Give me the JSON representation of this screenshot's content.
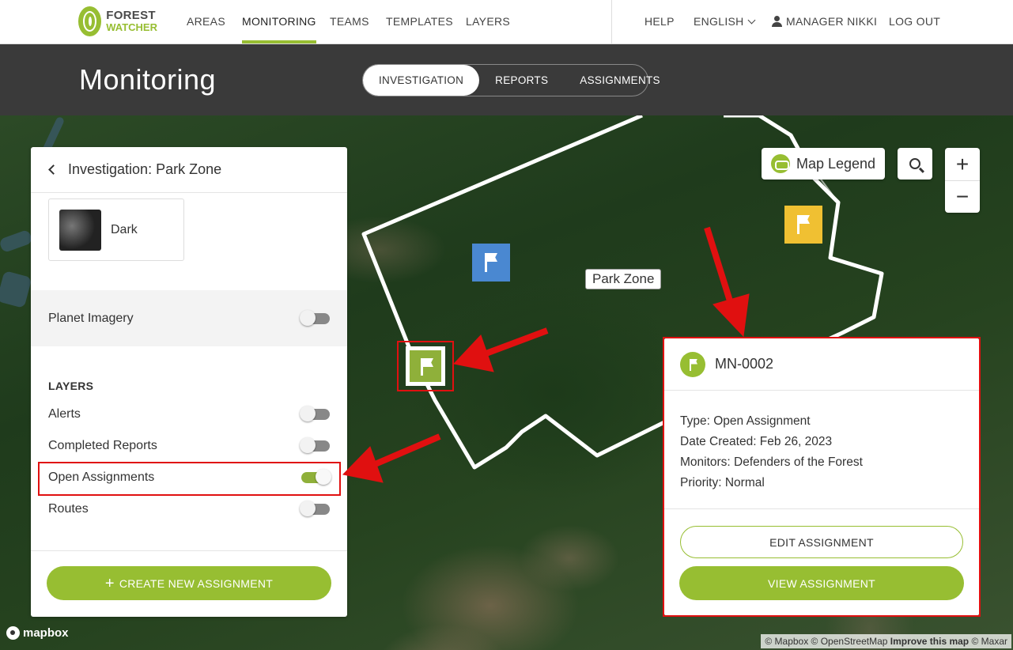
{
  "nav": {
    "logo_line1": "FOREST",
    "logo_line2": "WATCHER",
    "items": [
      "AREAS",
      "MONITORING",
      "TEAMS",
      "TEMPLATES",
      "LAYERS"
    ],
    "help": "HELP",
    "language": "ENGLISH",
    "user": "MANAGER NIKKI",
    "logout": "LOG OUT"
  },
  "subheader": {
    "title": "Monitoring",
    "tabs": [
      "INVESTIGATION",
      "REPORTS",
      "ASSIGNMENTS"
    ]
  },
  "panel": {
    "title": "Investigation: Park Zone",
    "basemap_label": "Dark",
    "planet_label": "Planet Imagery",
    "layers_title": "LAYERS",
    "layers": [
      {
        "label": "Alerts",
        "on": false
      },
      {
        "label": "Completed Reports",
        "on": false
      },
      {
        "label": "Open Assignments",
        "on": true
      },
      {
        "label": "Routes",
        "on": false
      }
    ],
    "create_button": "CREATE NEW ASSIGNMENT"
  },
  "map": {
    "zone_label": "Park Zone",
    "legend_button": "Map Legend",
    "zoom_in": "+",
    "zoom_out": "−",
    "mapbox_label": "mapbox",
    "attribution": {
      "a": "© Mapbox © OpenStreetMap",
      "b": "Improve this map",
      "c": "© Maxar"
    }
  },
  "popup": {
    "id": "MN-0002",
    "type": "Type: Open Assignment",
    "date": "Date Created: Feb 26, 2023",
    "monitors": "Monitors: Defenders of the Forest",
    "priority": "Priority: Normal",
    "edit_button": "EDIT ASSIGNMENT",
    "view_button": "VIEW ASSIGNMENT"
  },
  "colors": {
    "brand_green": "#97be32",
    "highlight_red": "#e01010",
    "marker_blue": "#4a88d1",
    "marker_yellow": "#f0c032"
  }
}
